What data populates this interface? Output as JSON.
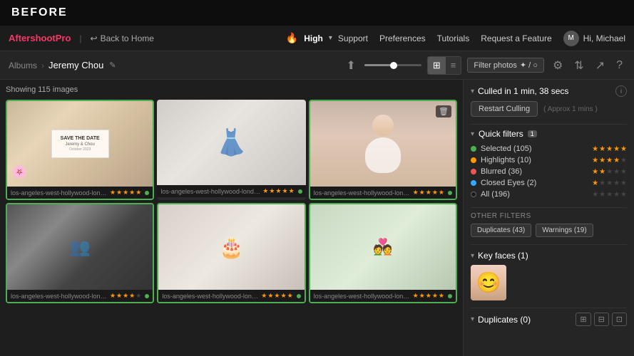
{
  "topBar": {
    "label": "BEFORE"
  },
  "navBar": {
    "brand": "Aftershoot",
    "brandSuffix": "Pro",
    "backLabel": "Back to Home",
    "quality": "High",
    "links": [
      "Support",
      "Preferences",
      "Tutorials",
      "Request a Feature"
    ],
    "user": "Hi, Michael"
  },
  "toolbar": {
    "breadcrumb": {
      "parent": "Albums",
      "current": "Jeremy Chou"
    },
    "filterLabel": "Filter photos",
    "filterSuffix": "✦ / ○"
  },
  "content": {
    "showing": "Showing 115 images",
    "photos": [
      {
        "name": "los-angeles-west-hollywood-london-...",
        "stars": 5,
        "dotColor": "green",
        "type": "invite"
      },
      {
        "name": "los-angeles-west-hollywood-london-...",
        "stars": 5,
        "dotColor": "green",
        "type": "dress"
      },
      {
        "name": "los-angeles-west-hollywood-london-...",
        "stars": 5,
        "dotColor": "green",
        "type": "bride",
        "hasTrash": true
      },
      {
        "name": "los-angeles-west-hollywood-london-...",
        "stars": 4,
        "dotColor": "green",
        "type": "groupbw"
      },
      {
        "name": "los-angeles-west-hollywood-london-...",
        "stars": 5,
        "dotColor": "green",
        "type": "cake"
      },
      {
        "name": "los-angeles-west-hollywood-london-...",
        "stars": 5,
        "dotColor": "green",
        "type": "outdoor"
      }
    ]
  },
  "sidebar": {
    "cullingTime": "Culled in 1 min, 38 secs",
    "restartBtn": "Restart Culling",
    "approxTime": "( Approx 1 mins )",
    "quickFilters": {
      "label": "Quick filters",
      "badge": "1",
      "filters": [
        {
          "label": "Selected (105)",
          "stars": 5,
          "dotColor": "green"
        },
        {
          "label": "Highlights (10)",
          "stars": 4,
          "dotColor": "yellow"
        },
        {
          "label": "Blurred (36)",
          "stars": 2,
          "dotColor": "orange"
        },
        {
          "label": "Closed Eyes (2)",
          "stars": 1,
          "dotColor": "blue"
        },
        {
          "label": "All (196)",
          "stars": 0,
          "dotColor": "black"
        }
      ]
    },
    "otherFilters": {
      "label": "Other Filters",
      "tags": [
        {
          "label": "Duplicates (43)"
        },
        {
          "label": "Warnings (19)"
        }
      ]
    },
    "keyFaces": {
      "label": "Key faces (1)"
    },
    "duplicates": {
      "label": "Duplicates (0)"
    }
  }
}
